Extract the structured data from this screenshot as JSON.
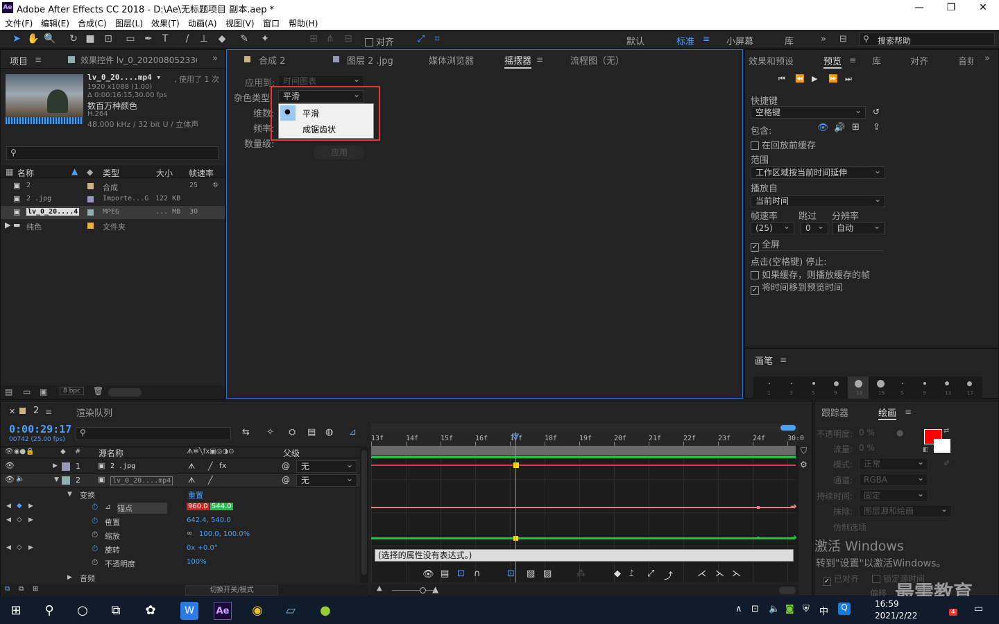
{
  "app": {
    "title": "Adobe After Effects CC 2018 - D:\\Ae\\无标题项目 副本.aep *",
    "logo": "Ae"
  },
  "menu": [
    "文件(F)",
    "编辑(E)",
    "合成(C)",
    "图层(L)",
    "效果(T)",
    "动画(A)",
    "视图(V)",
    "窗口",
    "帮助(H)"
  ],
  "toolbar": {
    "snap_label": "对齐",
    "workspaces": [
      "默认",
      "标准",
      "小屏幕",
      "库"
    ],
    "active_workspace": "标准",
    "search_placeholder": "搜索帮助"
  },
  "project": {
    "tab": "项目",
    "effect_tab": "效果控件 lv_0_2020080523360€",
    "file_name": "lv_0_20....mp4 ▾",
    "usage": ", 使用了 1 次",
    "info": [
      "1920 x1088 (1.00)",
      "Δ 0:00:16:15,30.00 fps",
      "数百万种颜色",
      "H.264",
      "48.000 kHz / 32 bit U / 立体声"
    ],
    "columns": [
      "名称",
      "类型",
      "大小",
      "帧速率"
    ],
    "rows": [
      {
        "name": "2",
        "type": "合成",
        "size": "",
        "fps": "25",
        "color": "#c9b386"
      },
      {
        "name": "2 .jpg",
        "type": "Importe...G",
        "size": "122 KB",
        "fps": "",
        "color": "#9898b8"
      },
      {
        "name": "lv_0_20....4",
        "type": "MPEG",
        "size": "... MB",
        "fps": "30",
        "color": "#8fb0b0"
      },
      {
        "name": "纯色",
        "type": "文件夹",
        "size": "",
        "fps": "",
        "color": "#e8b040"
      }
    ],
    "bpc": "8 bpc"
  },
  "center": {
    "tabs": [
      "合成 2",
      "图层 2 .jpg",
      "媒体浏览器",
      "摇摆器",
      "流程图（无）"
    ],
    "active_tab": "摇摆器",
    "labels": {
      "apply_to": "应用到:",
      "apply_to_value": "时间图表",
      "noise_type": "杂色类型:",
      "noise_value": "平滑",
      "dimension": "维数:",
      "frequency": "频率:",
      "magnitude": "数量级:",
      "apply_btn": "应用"
    },
    "dropdown_options": [
      "平滑",
      "成锯齿状"
    ],
    "selected_option": "平滑"
  },
  "preview": {
    "tabs": [
      "效果和预设",
      "预览",
      "库",
      "对齐",
      "音频"
    ],
    "active_tab": "预览",
    "shortcut_label": "快捷键",
    "shortcut_value": "空格键",
    "include_label": "包含:",
    "cache_before": "在回放前缓存",
    "range_label": "范围",
    "range_value": "工作区域按当前时间延伸",
    "play_from_label": "播放自",
    "play_from_value": "当前时间",
    "fps_label": "帧速率",
    "skip_label": "跳过",
    "res_label": "分辨率",
    "fps_value": "(25)",
    "skip_value": "0",
    "res_value": "自动",
    "fullscreen": "全屏",
    "stop_label": "点击(空格键) 停止:",
    "stop_opt1": "如果缓存，则播放缓存的帧",
    "stop_opt2": "将时间移到预览时间"
  },
  "brush": {
    "tab": "画笔",
    "sizes": [
      "1",
      "3",
      "5",
      "9",
      "13",
      "19",
      "5",
      "9",
      "13",
      "17"
    ]
  },
  "timeline": {
    "comp_tab": "2",
    "render_tab": "渲染队列",
    "time": "0:00:29:17",
    "frames": "00742 (25.00 fps)",
    "col_source": "源名称",
    "col_parent": "父级",
    "layers": [
      {
        "num": "1",
        "name": "2 .jpg",
        "parent": "无",
        "color": "#9898b8"
      },
      {
        "num": "2",
        "name": "lv_0_20....mp4",
        "parent": "无",
        "color": "#8fb0b0"
      }
    ],
    "transform": "变换",
    "reset": "重置",
    "props": [
      {
        "name": "锚点",
        "value": "",
        "v1": "960.0",
        "v2": "544.0"
      },
      {
        "name": "位置",
        "value": "642.4, 540.0"
      },
      {
        "name": "缩放",
        "value": "100.0, 100.0%"
      },
      {
        "name": "旋转",
        "value": "0x +0.0°"
      },
      {
        "name": "不透明度",
        "value": "100%"
      }
    ],
    "audio": "音频",
    "toggle_label": "切换开关/模式",
    "ruler": [
      "13f",
      "14f",
      "15f",
      "16f",
      "17f",
      "18f",
      "19f",
      "20f",
      "21f",
      "22f",
      "23f",
      "24f",
      "30:0"
    ],
    "expression_text": "(选择的属性没有表达式。)"
  },
  "tracker": {
    "tab": "跟踪器"
  },
  "paint": {
    "tab": "绘画",
    "opacity_label": "不透明度:",
    "opacity_value": "0 %",
    "flow_label": "流量:",
    "flow_value": "0 %",
    "mode_label": "模式:",
    "mode_value": "正常",
    "channel_label": "通道:",
    "channel_value": "RGBA",
    "duration_label": "持续时间:",
    "duration_value": "固定",
    "erase_label": "抹除:",
    "erase_value": "图层源和绘画",
    "clone_label": "仿制选项",
    "aligned": "已对齐",
    "lock_time": "锁定源时间",
    "offset_label": "偏移",
    "color": "#ff0000"
  },
  "watermark": {
    "line1": "激活 Windows",
    "line2": "转到\"设置\"以激活Windows。",
    "brand": "最需教育"
  },
  "taskbar": {
    "time": "16:59",
    "date": "2021/2/22",
    "ime": "中",
    "notif": "4"
  }
}
